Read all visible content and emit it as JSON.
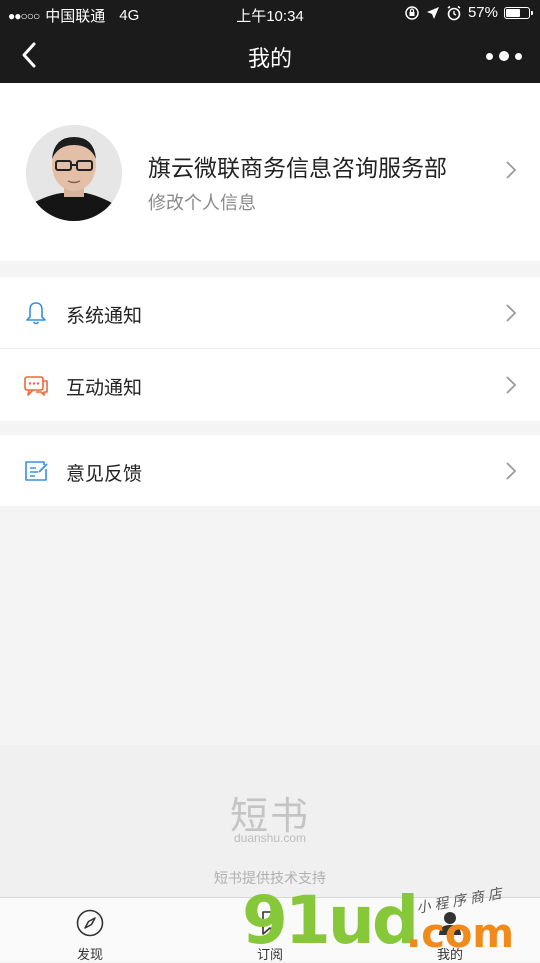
{
  "status_bar": {
    "signal_dots": "●●○○○",
    "carrier": "中国联通",
    "network": "4G",
    "time": "上午10:34",
    "battery_text": "57%",
    "battery_level": 0.57
  },
  "nav": {
    "title": "我的"
  },
  "profile": {
    "name": "旗云微联商务信息咨询服务部",
    "subtitle": "修改个人信息"
  },
  "menu": {
    "group1": [
      {
        "label": "系统通知",
        "icon": "bell-icon"
      },
      {
        "label": "互动通知",
        "icon": "chat-bubbles-icon"
      }
    ],
    "group2": [
      {
        "label": "意见反馈",
        "icon": "feedback-edit-icon"
      }
    ]
  },
  "branding": {
    "logo": "短书",
    "domain": "duanshu.com",
    "support": "短书提供技术支持"
  },
  "tabs": [
    {
      "label": "发现",
      "icon": "compass-icon"
    },
    {
      "label": "订阅",
      "icon": "bookmark-icon"
    },
    {
      "label": "我的",
      "icon": "user-icon"
    }
  ],
  "watermark": {
    "main": "91ud",
    "suffix": ".com",
    "tagline": "小程序商店"
  },
  "colors": {
    "header_bg": "#1b1b1b",
    "bell_icon": "#3a8ee6",
    "chat_icon": "#f0673a",
    "feedback_icon": "#3a8ee6"
  }
}
